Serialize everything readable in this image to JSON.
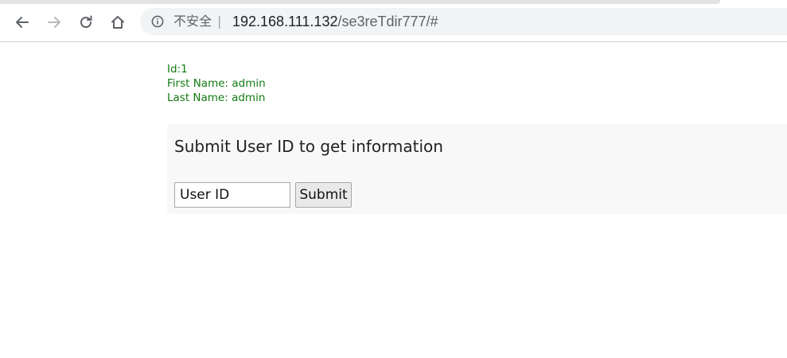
{
  "browser": {
    "security_label": "不安全",
    "separator": "|",
    "url_host": "192.168.111.132",
    "url_path": "/se3reTdir777/#",
    "icons": {
      "back": "back-arrow-icon",
      "forward": "forward-arrow-icon",
      "reload": "reload-icon",
      "home": "home-icon",
      "info": "info-icon"
    }
  },
  "result": {
    "id_line": "Id:1",
    "first_name_line": "First Name: admin",
    "last_name_line": "Last Name: admin",
    "color": "#117a11"
  },
  "form": {
    "title": "Submit User ID to get information",
    "input_placeholder": "User ID",
    "input_value": "",
    "submit_label": "Submit"
  }
}
